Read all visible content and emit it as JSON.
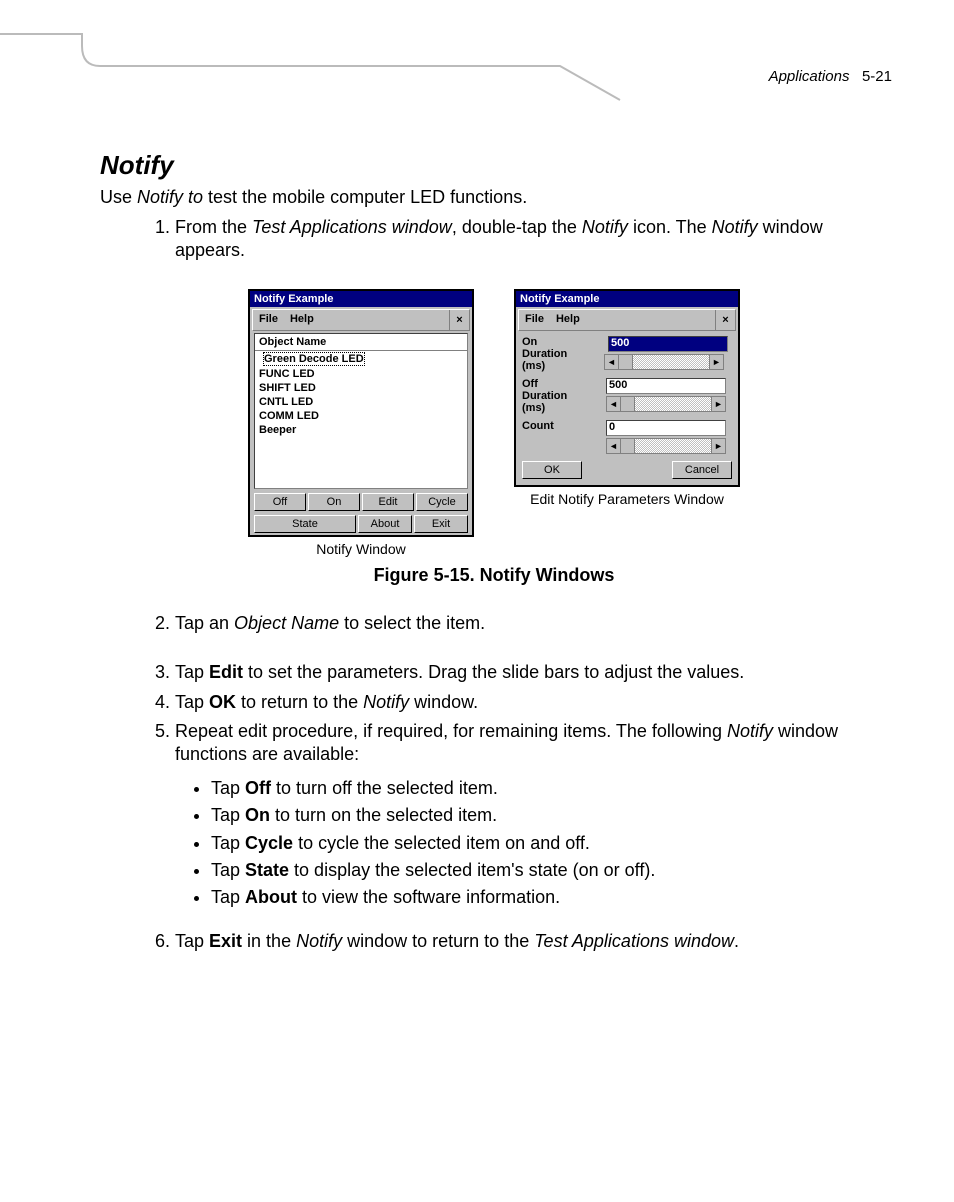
{
  "header": {
    "section": "Applications",
    "page": "5-21"
  },
  "title": "Notify",
  "intro": {
    "pre": "Use ",
    "em": "Notify to",
    "post": " test the mobile computer LED functions."
  },
  "steps": [
    {
      "n": 1,
      "parts": [
        "From the ",
        {
          "em": "Test Applications window"
        },
        ", double-tap the ",
        {
          "em": "Notify"
        },
        " icon. The ",
        {
          "em": "Notify"
        },
        " window appears."
      ]
    },
    {
      "n": 2,
      "parts": [
        "Tap an ",
        {
          "em": "Object Name"
        },
        " to select the item."
      ]
    },
    {
      "n": 3,
      "parts": [
        "Tap ",
        {
          "b": "Edit"
        },
        " to set the parameters. Drag the slide bars to adjust the values."
      ]
    },
    {
      "n": 4,
      "parts": [
        "Tap ",
        {
          "b": "OK"
        },
        " to return to the ",
        {
          "em": "Notify"
        },
        " window."
      ]
    },
    {
      "n": 5,
      "parts": [
        "Repeat edit procedure, if required, for remaining items. The following ",
        {
          "em": "Notify"
        },
        " window functions are available:"
      ]
    },
    {
      "n": 6,
      "parts": [
        "Tap ",
        {
          "b": "Exit"
        },
        " in the ",
        {
          "em": "Notify"
        },
        " window to return to the ",
        {
          "em": "Test Applications window"
        },
        "."
      ]
    }
  ],
  "bullets": [
    [
      "Tap ",
      {
        "b": "Off"
      },
      " to turn off the selected item."
    ],
    [
      "Tap ",
      {
        "b": "On"
      },
      " to turn on the selected item."
    ],
    [
      "Tap ",
      {
        "b": "Cycle"
      },
      " to cycle the selected item on and off."
    ],
    [
      "Tap ",
      {
        "b": "State"
      },
      " to display the selected item's state (on or off)."
    ],
    [
      "Tap ",
      {
        "b": "About"
      },
      " to view the software information."
    ]
  ],
  "figure": {
    "name": "Figure 5-15.  Notify Windows",
    "leftCaption": "Notify Window",
    "rightCaption": "Edit Notify Parameters Window"
  },
  "win1": {
    "title": "Notify Example",
    "menu": [
      "File",
      "Help"
    ],
    "listHeader": "Object Name",
    "items": [
      "Green Decode LED",
      "FUNC LED",
      "SHIFT LED",
      "CNTL LED",
      "COMM LED",
      "Beeper"
    ],
    "selectedIndex": 0,
    "btns1": [
      "Off",
      "On",
      "Edit",
      "Cycle"
    ],
    "btns2": [
      "State",
      "About",
      "Exit"
    ]
  },
  "win2": {
    "title": "Notify Example",
    "menu": [
      "File",
      "Help"
    ],
    "params": [
      {
        "label": "On Duration (ms)",
        "value": "500",
        "selected": true
      },
      {
        "label": "Off Duration (ms)",
        "value": "500",
        "selected": false
      },
      {
        "label": "Count",
        "value": "0",
        "selected": false
      }
    ],
    "ok": "OK",
    "cancel": "Cancel"
  }
}
